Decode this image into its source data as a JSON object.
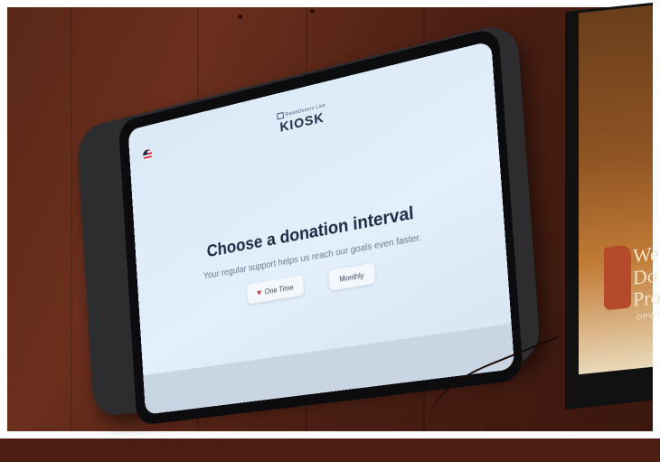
{
  "kiosk": {
    "brand_top": "RaiseDonors Live",
    "brand_main": "KIOSK",
    "title": "Choose a donation interval",
    "subtitle": "Your regular support helps us reach our goals even faster.",
    "buttons": {
      "one_time": "One Time",
      "monthly": "Monthly"
    }
  },
  "poster": {
    "lines": [
      "We",
      "Do",
      "Pro"
    ],
    "sub": "OPWE"
  },
  "colors": {
    "screen_bg": "#dbe9f7",
    "title": "#1d2b45",
    "heart": "#d1293d",
    "wall": "#5a2818"
  }
}
